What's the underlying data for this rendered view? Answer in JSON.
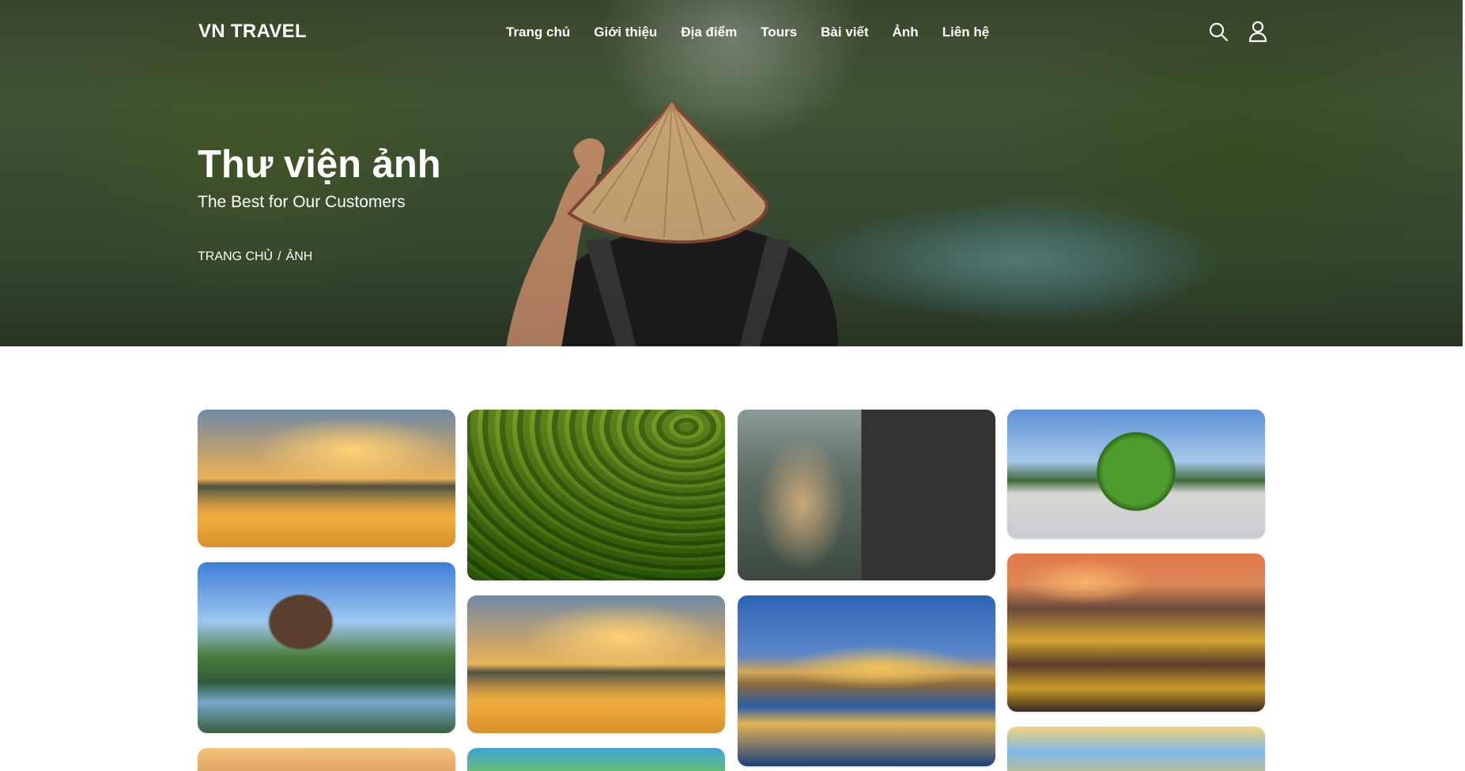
{
  "site": {
    "logo": "VN TRAVEL"
  },
  "nav": {
    "items": [
      "Trang chủ",
      "Giới thiệu",
      "Địa điểm",
      "Tours",
      "Bài viết",
      "Ảnh",
      "Liên hệ"
    ]
  },
  "icons": {
    "search": "search-icon",
    "user": "user-icon"
  },
  "hero": {
    "title": "Thư viện ảnh",
    "subtitle": "The Best for Our Customers",
    "breadcrumb": {
      "home": "TRANG CHỦ",
      "separator": "/",
      "current": "ẢNH"
    }
  },
  "colors": {
    "hero_text": "#ffffff",
    "placeholder_panel": "#333333",
    "page_bg": "#ffffff"
  }
}
